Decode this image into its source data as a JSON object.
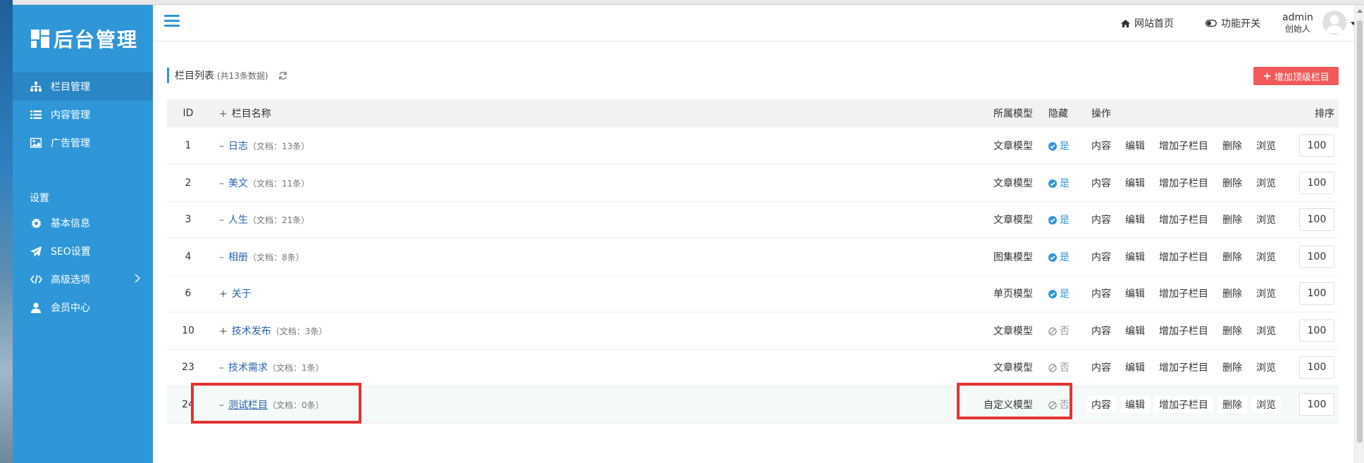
{
  "sidebar": {
    "logo_text": "后台管理",
    "nav": [
      {
        "label": "栏目管理",
        "icon": "sitemap-icon",
        "active": true
      },
      {
        "label": "内容管理",
        "icon": "list-icon"
      },
      {
        "label": "广告管理",
        "icon": "image-icon"
      }
    ],
    "settings_group": "设置",
    "settings": [
      {
        "label": "基本信息",
        "icon": "gear-icon"
      },
      {
        "label": "SEO设置",
        "icon": "paper-plane-icon"
      },
      {
        "label": "高级选项",
        "icon": "code-icon",
        "has_submenu": true
      },
      {
        "label": "会员中心",
        "icon": "user-icon"
      }
    ]
  },
  "topbar": {
    "home_link": "网站首页",
    "feature_toggle": "功能开关",
    "admin_name": "admin",
    "admin_role": "创始人"
  },
  "panel": {
    "title": "栏目列表",
    "count_text": "(共13条数据)",
    "add_button": "增加顶级栏目"
  },
  "table": {
    "headers": {
      "id": "ID",
      "name": "栏目名称",
      "model": "所属模型",
      "hidden": "隐藏",
      "ops": "操作",
      "sort": "排序"
    },
    "ops": [
      "内容",
      "编辑",
      "增加子栏目",
      "删除",
      "浏览"
    ],
    "rows": [
      {
        "id": "1",
        "toggle": "–",
        "name": "日志",
        "docs": "（文档：13条）",
        "model": "文章模型",
        "hidden": "是",
        "sort": "100"
      },
      {
        "id": "2",
        "toggle": "–",
        "name": "美文",
        "docs": "（文档：11条）",
        "model": "文章模型",
        "hidden": "是",
        "sort": "100"
      },
      {
        "id": "3",
        "toggle": "–",
        "name": "人生",
        "docs": "（文档：21条）",
        "model": "文章模型",
        "hidden": "是",
        "sort": "100"
      },
      {
        "id": "4",
        "toggle": "–",
        "name": "相册",
        "docs": "（文档：8条）",
        "model": "图集模型",
        "hidden": "是",
        "sort": "100"
      },
      {
        "id": "6",
        "toggle": "+",
        "name": "关于",
        "docs": "",
        "model": "单页模型",
        "hidden": "是",
        "sort": "100"
      },
      {
        "id": "10",
        "toggle": "+",
        "name": "技术发布",
        "docs": "（文档：3条）",
        "model": "文章模型",
        "hidden": "否",
        "sort": "100"
      },
      {
        "id": "23",
        "toggle": "–",
        "name": "技术需求",
        "docs": "（文档：1条）",
        "model": "文章模型",
        "hidden": "否",
        "sort": "100"
      },
      {
        "id": "24",
        "toggle": "–",
        "name": "测试栏目",
        "docs": "（文档：0条）",
        "model": "自定义模型",
        "hidden": "否",
        "sort": "100",
        "highlighted": true
      }
    ]
  },
  "colors": {
    "sidebar": "#2f97d8",
    "accent": "#2f97d8",
    "add_button": "#f25a5a",
    "annotation": "#e53333"
  }
}
